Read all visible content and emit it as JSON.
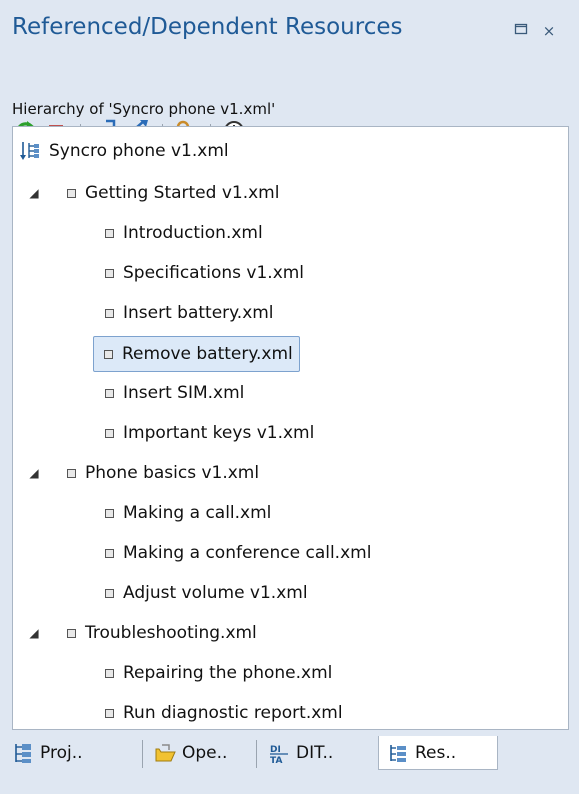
{
  "panel": {
    "title": "Referenced/Dependent Resources",
    "maximize_icon": "maximize-icon",
    "close_icon": "close-icon",
    "close_glyph": "×"
  },
  "toolbar": {
    "refresh_icon": "refresh-icon",
    "stop_icon": "stop-icon",
    "open_folder_icon": "open-folder-icon",
    "open_folder_alt_icon": "open-folder-alt-icon",
    "key_icon": "dependency-key-icon",
    "history_icon": "history-dropdown-icon"
  },
  "hierarchy_label": "Hierarchy of 'Syncro phone v1.xml'",
  "tree": {
    "root": "Syncro phone v1.xml",
    "groups": [
      {
        "label": "Getting Started v1.xml",
        "children": [
          "Introduction.xml",
          "Specifications v1.xml",
          "Insert battery.xml",
          "Remove battery.xml",
          "Insert SIM.xml",
          "Important keys v1.xml"
        ]
      },
      {
        "label": "Phone basics v1.xml",
        "children": [
          "Making a call.xml",
          "Making a conference call.xml",
          "Adjust volume v1.xml"
        ]
      },
      {
        "label": "Troubleshooting.xml",
        "children": [
          "Repairing the phone.xml",
          "Run diagnostic report.xml"
        ]
      }
    ],
    "selected": "Remove battery.xml"
  },
  "tabs": [
    {
      "label": "Proj..",
      "icon": "project-icon"
    },
    {
      "label": "Ope..",
      "icon": "open-files-icon"
    },
    {
      "label": "DIT..",
      "icon": "dita-maps-icon"
    },
    {
      "label": "Res..",
      "icon": "resources-hierarchy-icon",
      "active": true
    }
  ],
  "colors": {
    "title": "#1f5a96",
    "panel_bg": "#dfe7f2",
    "selection_bg": "#dce9f8",
    "refresh_green": "#2ca02c",
    "stop_red": "#c0504d"
  }
}
